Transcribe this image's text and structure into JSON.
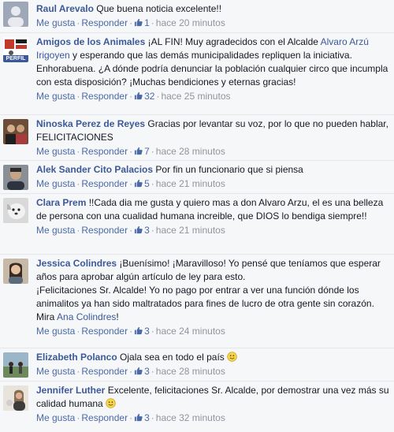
{
  "labels": {
    "like": "Me gusta",
    "reply": "Responder",
    "sep": "·"
  },
  "comments": [
    {
      "author": "Raul Arevalo",
      "text": "Que buena noticia excelente!!",
      "likes": "1",
      "time": "hace 20 minutos"
    },
    {
      "author": "Amigos de los Animales",
      "text_a": "¡AL FIN! Muy agradecidos con el Alcalde",
      "mention": "Alvaro Arzú Irigoyen",
      "text_b": "y esperando que las demás municipalidades repliquen la iniciativa. Enhorabuena. ¿A dónde podría denunciar la población cualquier circo que incumpla con esta disposición? ¡Muchas bendiciones y eternas gracias!",
      "badge": "PERFIL",
      "likes": "32",
      "time": "hace 25 minutos"
    },
    {
      "author": "Ninoska Perez de Reyes",
      "text": "Gracias por levantar su voz, por lo que no pueden hablar, FELICITACIONES",
      "likes": "7",
      "time": "hace 28 minutos"
    },
    {
      "author": "Alek Sander Cito Palacios",
      "text": "Por fin un funcionario que si piensa",
      "likes": "5",
      "time": "hace 21 minutos"
    },
    {
      "author": "Clara Prem",
      "text": "!!Cada dia me gusta y quiero mas a don Alvaro Arzu, el es una belleza de persona con una cualidad humana increible, que DIOS lo bendiga siempre!!",
      "likes": "3",
      "time": "hace 21 minutos"
    },
    {
      "author": "Jessica Colindres",
      "text_a": "¡Buenísimo! ¡Maravilloso! Yo pensé que teníamos que esperar años para aprobar algún artículo de ley para esto.",
      "text_b": "¡Felicitaciones Sr. Alcalde! Yo no pago por entrar a ver una función dónde los animalitos ya han sido maltratados para fines de lucro de otra gente sin corazón.",
      "text_c": "Mira",
      "mention": "Ana Colindres",
      "text_d": "!",
      "likes": "3",
      "time": "hace 24 minutos"
    },
    {
      "author": "Elizabeth Polanco",
      "text": "Ojala sea en todo el país",
      "emoji": "smile-emoji",
      "likes": "3",
      "time": "hace 28 minutos"
    },
    {
      "author": "Jennifer Luther",
      "text": "Excelente, felicitaciones Sr. Alcalde, por demostrar una vez más su calidad humana",
      "emoji": "smile-emoji",
      "likes": "3",
      "time": "hace 32 minutos"
    }
  ],
  "colors": {
    "link": "#3b5998",
    "meta": "#90949c",
    "background": "#f6f7f9"
  }
}
